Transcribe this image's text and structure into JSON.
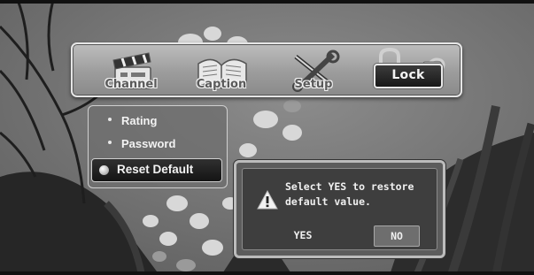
{
  "top_menu": {
    "items": [
      {
        "label": "Channel",
        "icon": "clapperboard-icon"
      },
      {
        "label": "Caption",
        "icon": "open-book-icon"
      },
      {
        "label": "Setup",
        "icon": "tools-icon"
      },
      {
        "label": "Lock",
        "icon": "padlock-icon",
        "selected": true
      }
    ]
  },
  "submenu": {
    "items": [
      {
        "label": "Rating"
      },
      {
        "label": "Password"
      },
      {
        "label": "Reset Default",
        "selected": true
      }
    ]
  },
  "dialog": {
    "icon": "warning-icon",
    "message_line1": "Select YES to restore",
    "message_line2": "default value.",
    "yes_label": "YES",
    "no_label": "NO",
    "focused_button": "NO"
  },
  "colors": {
    "menubar": "#a8a8a8",
    "selection": "#1e1e1e",
    "dialog_bg": "#3e3e3e",
    "text": "#f0f0f0"
  }
}
